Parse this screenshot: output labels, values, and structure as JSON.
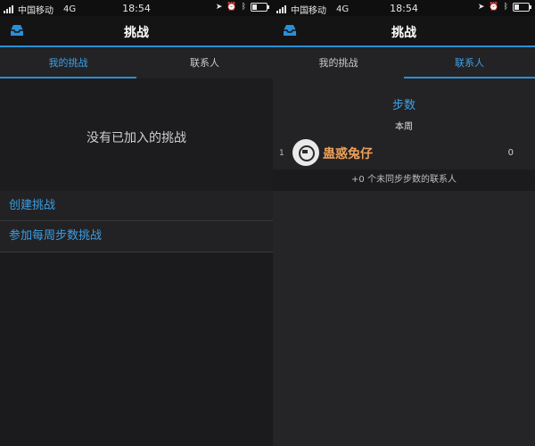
{
  "status_bar": {
    "carrier": "中国移动",
    "network": "4G",
    "time": "18:54",
    "indicators": [
      "location-icon",
      "alarm-icon",
      "bluetooth-icon",
      "battery-icon"
    ]
  },
  "left": {
    "header": {
      "title": "挑战",
      "icon": "inbox-icon"
    },
    "tabs": [
      {
        "label": "我的挑战",
        "active": true
      },
      {
        "label": "联系人",
        "active": false
      }
    ],
    "empty_text": "没有已加入的挑战",
    "actions": [
      {
        "label": "创建挑战"
      },
      {
        "label": "参加每周步数挑战"
      }
    ]
  },
  "right": {
    "header": {
      "title": "挑战",
      "icon": "inbox-icon"
    },
    "tabs": [
      {
        "label": "我的挑战",
        "active": false
      },
      {
        "label": "联系人",
        "active": true
      }
    ],
    "section_title": "步数",
    "section_sub": "本周",
    "leaderboard": [
      {
        "rank": "1",
        "name": "蛊惑兔仔",
        "score": "0"
      }
    ],
    "unsynced_text": "+0 个未同步步数的联系人"
  },
  "colors": {
    "accent": "#2b8fd6",
    "accent_text": "#3ea0e8",
    "username": "#f0a15a",
    "background": "#1b1b1d"
  }
}
